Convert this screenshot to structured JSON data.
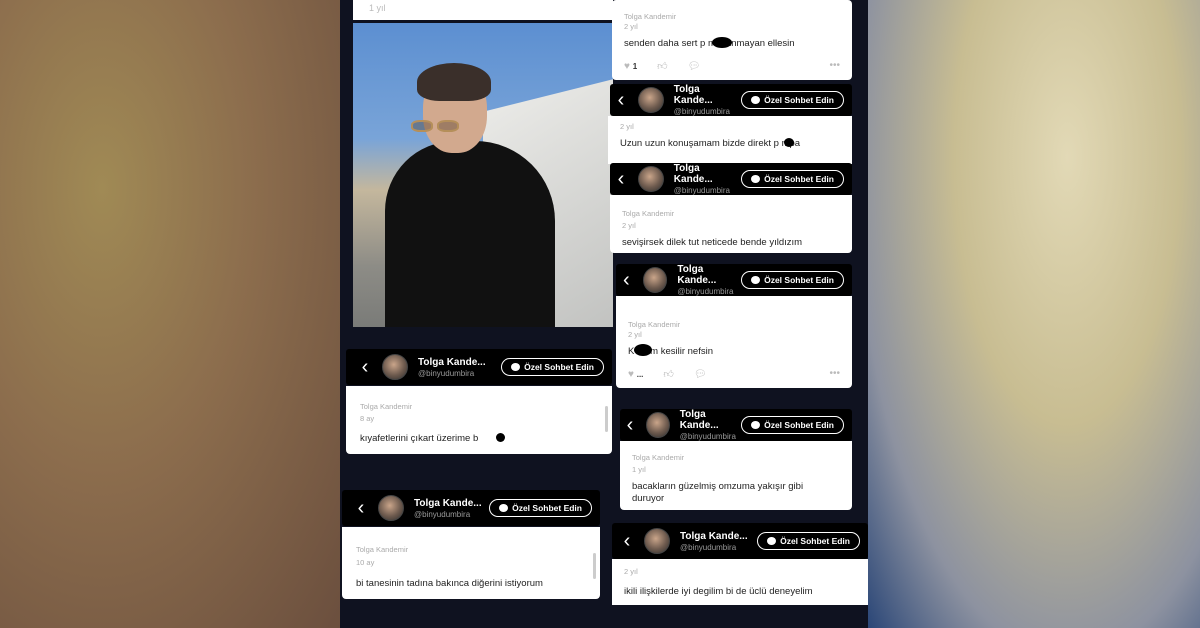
{
  "profile": {
    "name": "Tolga Kande...",
    "handle": "@binyudumbira",
    "chat_button": "Özel Sohbet Edin",
    "commenter": "Tolga Kandemir"
  },
  "top_left_time": "1 yıl",
  "comments": [
    {
      "time": "2 yıl",
      "text": "senden daha sert p   m inanmayan ellesin",
      "likes": "1"
    },
    {
      "time": "2 yıl",
      "text": "Uzun uzun konuşamam bizde direkt p   mpa"
    },
    {
      "time": "2 yıl",
      "text": "sevişirsek dilek tut neticede bende yıldızım"
    },
    {
      "time": "2 yıl",
      "text": "K   rsem kesilir nefsin",
      "likes": "..."
    },
    {
      "time": "8 ay",
      "text": "kıyafetlerini çıkart üzerime b"
    },
    {
      "time": "1 yıl",
      "text": "bacakların güzelmiş omzuma yakışır gibi duruyor"
    },
    {
      "time": "10 ay",
      "text": "bi tanesinin tadına bakınca diğerini istiyorum"
    },
    {
      "time": "2 yıl",
      "text": "ikili ilişkilerde iyi degilim bi de üclü deneyelim"
    }
  ],
  "icons": {
    "back": "chevron-left-icon",
    "chat": "chat-bubble-icon",
    "heart": "heart-icon",
    "thumb": "thumbs-up-icon",
    "reply": "reply-icon",
    "more": "more-dots-icon"
  }
}
